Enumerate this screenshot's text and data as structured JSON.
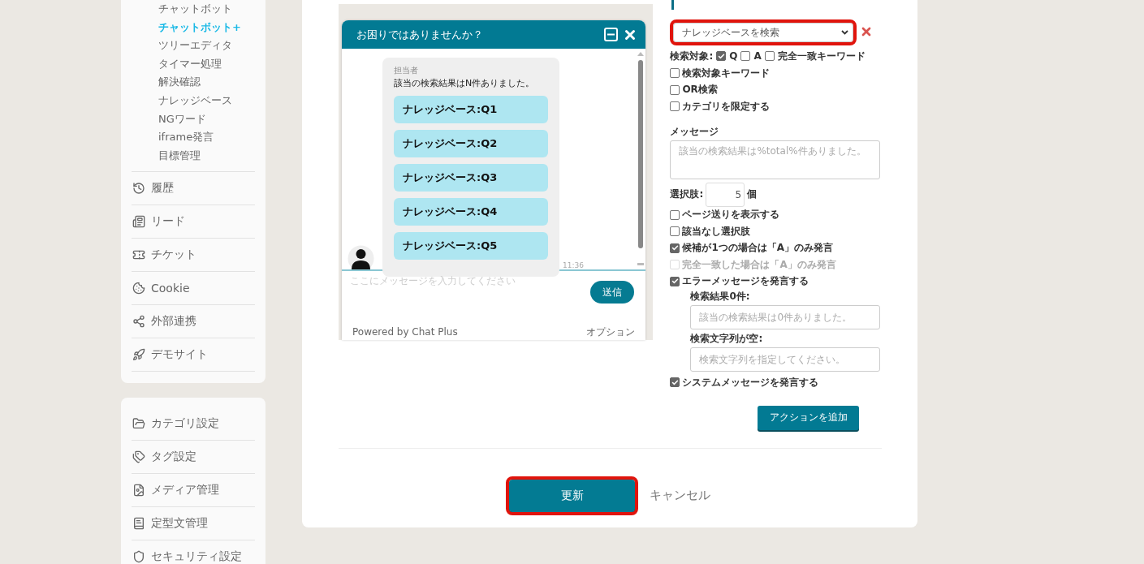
{
  "sidebar": {
    "subitems": [
      {
        "label": "チャットボット",
        "selected": false
      },
      {
        "label": "チャットボット+",
        "selected": true
      },
      {
        "label": "ツリーエディタ",
        "selected": false
      },
      {
        "label": "タイマー処理",
        "selected": false
      },
      {
        "label": "解決確認",
        "selected": false
      },
      {
        "label": "ナレッジベース",
        "selected": false
      },
      {
        "label": "NGワード",
        "selected": false
      },
      {
        "label": "iframe発言",
        "selected": false
      },
      {
        "label": "目標管理",
        "selected": false
      }
    ],
    "items": [
      {
        "label": "履歴"
      },
      {
        "label": "リード"
      },
      {
        "label": "チケット"
      },
      {
        "label": "Cookie"
      },
      {
        "label": "外部連携"
      },
      {
        "label": "デモサイト"
      }
    ],
    "settings": [
      {
        "label": "カテゴリ設定"
      },
      {
        "label": "タグ設定"
      },
      {
        "label": "メディア管理"
      },
      {
        "label": "定型文管理"
      },
      {
        "label": "セキュリティ設定"
      }
    ]
  },
  "chat": {
    "title": "お困りではありませんか？",
    "sender": "担当者",
    "message": "該当の検索結果はN件ありました。",
    "choices": [
      "ナレッジベース:Q1",
      "ナレッジベース:Q2",
      "ナレッジベース:Q3",
      "ナレッジベース:Q4",
      "ナレッジベース:Q5"
    ],
    "time": "11:36",
    "input_placeholder": "ここにメッセージを入力してください",
    "send": "送信",
    "powered": "Powered by Chat Plus",
    "options": "オプション"
  },
  "action": {
    "select": {
      "value": "ナレッジベースを検索",
      "highlighted": true
    },
    "target_label": "検索対象:",
    "targets": [
      {
        "label": "Q",
        "checked": true
      },
      {
        "label": "A",
        "checked": false
      },
      {
        "label": "完全一致キーワード",
        "checked": false
      }
    ],
    "filters": [
      {
        "label": "検索対象キーワード",
        "checked": false
      },
      {
        "label": "OR検索",
        "checked": false
      },
      {
        "label": "カテゴリを限定する",
        "checked": false
      }
    ],
    "message_label": "メッセージ",
    "message_placeholder": "該当の検索結果は%total%件ありました。",
    "choices_label": "選択肢:",
    "choices_value": "5",
    "choices_unit": "個",
    "options": [
      {
        "label": "ページ送りを表示する",
        "checked": false,
        "disabled": false
      },
      {
        "label": "該当なし選択肢",
        "checked": false,
        "disabled": false
      },
      {
        "label": "候補が1つの場合は「A」のみ発言",
        "checked": true,
        "disabled": false
      },
      {
        "label": "完全一致した場合は「A」のみ発言",
        "checked": false,
        "disabled": true
      },
      {
        "label": "エラーメッセージを発言する",
        "checked": true,
        "disabled": false
      }
    ],
    "error_fields": [
      {
        "label": "検索結果0件:",
        "placeholder": "該当の検索結果は0件ありました。"
      },
      {
        "label": "検索文字列が空:",
        "placeholder": "検索文字列を指定してください。"
      }
    ],
    "system_message": {
      "label": "システムメッセージを発言する",
      "checked": true
    },
    "add_button": "アクションを追加"
  },
  "footer": {
    "update": {
      "label": "更新",
      "highlighted": true
    },
    "cancel": "キャンセル"
  }
}
